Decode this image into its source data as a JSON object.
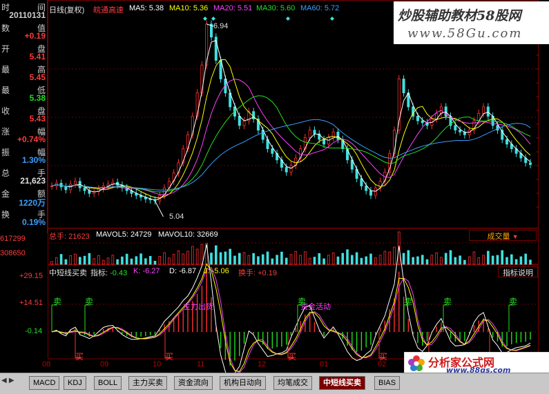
{
  "left_panel": {
    "items": [
      {
        "label": "时",
        "label2": "间",
        "value": "20110131",
        "color": "#d0d0d0"
      },
      {
        "label": "数",
        "label2": "值",
        "value": "+0.19",
        "color": "#ff3b3b"
      },
      {
        "label": "开",
        "label2": "盘",
        "value": "5.41",
        "color": "#ff3b3b"
      },
      {
        "label": "最",
        "label2": "高",
        "value": "5.45",
        "color": "#ff3b3b"
      },
      {
        "label": "最",
        "label2": "低",
        "value": "5.38",
        "color": "#22e022"
      },
      {
        "label": "收",
        "label2": "盘",
        "value": "5.43",
        "color": "#ff3b3b"
      },
      {
        "label": "涨",
        "label2": "幅",
        "value": "+0.74%",
        "color": "#ff3b3b"
      },
      {
        "label": "振",
        "label2": "幅",
        "value": "1.30%",
        "color": "#3aa0ff"
      },
      {
        "label": "总",
        "label2": "手",
        "value": "21,623",
        "color": "#e0e0e0"
      },
      {
        "label": "金",
        "label2": "额",
        "value": "1220万",
        "color": "#3aa0ff"
      },
      {
        "label": "换",
        "label2": "手",
        "value": "0.19%",
        "color": "#3aa0ff"
      }
    ]
  },
  "main_header": {
    "period": "日线(复权)",
    "stock": "皖通高速",
    "ma5_label": "MA5:",
    "ma5": "5.38",
    "ma10_label": "MA10:",
    "ma10": "5.36",
    "ma20_label": "MA20:",
    "ma20": "5.51",
    "ma30_label": "MA30:",
    "ma30": "5.60",
    "ma60_label": "MA60:",
    "ma60": "5.72"
  },
  "price_annotations": {
    "high": "6.94",
    "low": "5.04"
  },
  "volume_header": {
    "vol_label": "总手:",
    "vol": "21623",
    "mavol5_label": "MAVOL5:",
    "mavol5": "24729",
    "mavol10_label": "MAVOL10:",
    "mavol10": "32669",
    "selector": "成交量"
  },
  "volume_axis": [
    "617299",
    "308650"
  ],
  "indicator_header": {
    "name": "中短线买卖",
    "zb_label": "指标:",
    "zb": "-0.43",
    "k_label": "K:",
    "k": "-6.27",
    "d_label": "D:",
    "d": "-6.87",
    "j_label": "J:",
    "j": "-5.06",
    "hs_label": "换手:",
    "hs": "+0.19",
    "help": "指标说明"
  },
  "indicator_axis": [
    "+29.15",
    "+14.51",
    "-0.14"
  ],
  "indicator_annotations": {
    "sell": "卖",
    "buy": "买",
    "main_out": "主力出货",
    "fund_active": "资金活动"
  },
  "x_axis": [
    "08",
    "09",
    "10",
    "11",
    "12",
    "01",
    "02"
  ],
  "tabs": [
    "MACD",
    "KDJ",
    "BOLL",
    "主力买卖",
    "资金流向",
    "机构日动向",
    "均笔成交",
    "中短线买卖",
    "BIAS"
  ],
  "active_tab": "中短线买卖",
  "watermark_top": {
    "line1": "炒股辅助教材58股网",
    "line2": "www.58Gu.com"
  },
  "watermark_bottom": {
    "line1": "分析家公式网",
    "line2": "www.88gs.com"
  },
  "chart_data": {
    "type": "line",
    "series": [
      {
        "values": [
          5.2,
          5.23,
          5.19,
          5.16,
          5.22,
          5.25,
          5.18,
          5.15,
          5.12,
          5.14,
          5.17,
          5.2,
          5.22,
          5.24,
          5.21,
          5.18,
          5.15,
          5.12,
          5.1,
          5.08,
          5.06,
          5.05,
          5.04,
          5.1,
          5.18,
          5.25,
          5.34,
          5.45,
          5.6,
          5.75,
          5.95,
          6.2,
          6.5,
          6.94,
          6.8,
          6.55,
          6.35,
          6.2,
          6.05,
          5.95,
          5.85,
          5.9,
          6.0,
          5.92,
          5.8,
          5.7,
          5.6,
          5.55,
          5.48,
          5.4,
          5.35,
          5.42,
          5.5,
          5.6,
          5.72,
          5.8,
          5.76,
          5.7,
          5.65,
          5.72,
          5.78,
          5.7,
          5.6,
          5.48,
          5.38,
          5.28,
          5.2,
          5.15,
          5.1,
          5.18,
          5.25,
          5.35,
          5.55,
          5.8,
          6.35,
          6.2,
          6.05,
          5.95,
          5.9,
          5.88,
          5.85,
          5.92,
          5.98,
          6.05,
          5.95,
          5.85,
          5.8,
          5.78,
          5.75,
          5.8,
          5.9,
          5.98,
          6.05,
          5.95,
          5.85,
          5.8,
          5.7,
          5.65,
          5.6,
          5.55,
          5.5,
          5.45,
          5.43
        ]
      }
    ]
  }
}
